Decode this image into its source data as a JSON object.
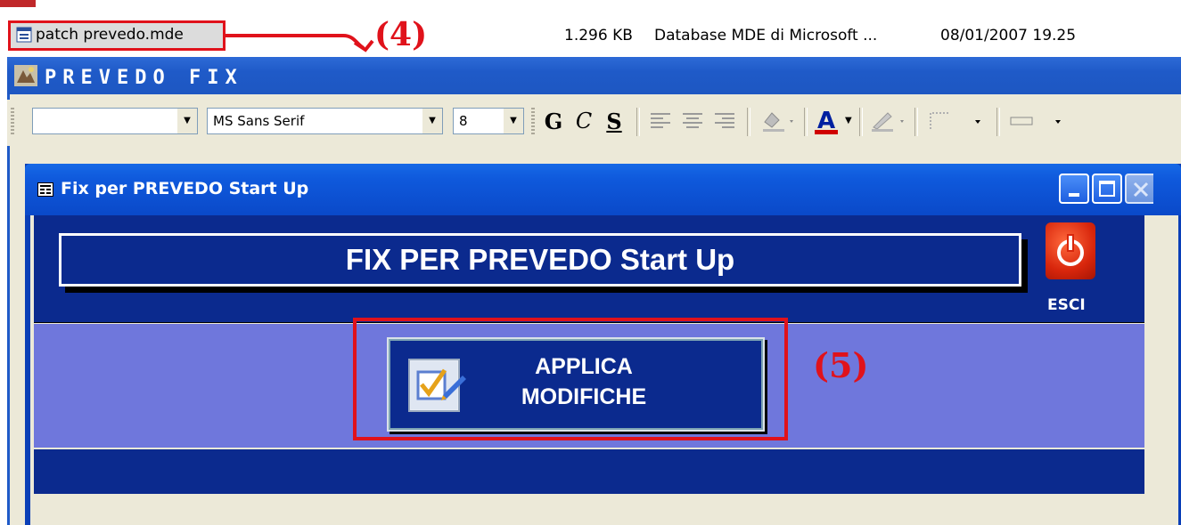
{
  "explorer_row": {
    "file_name": "patch prevedo.mde",
    "file_size": "1.296 KB",
    "file_type": "Database MDE di Microsoft ...",
    "file_date": "08/01/2007 19.25"
  },
  "annotations": {
    "step4": "4",
    "step5": "5",
    "color": "#e0121b"
  },
  "app": {
    "title": "PREVEDO FIX"
  },
  "toolbar": {
    "object_combo": "",
    "font_combo": "MS Sans Serif",
    "size_combo": "8",
    "bold_label": "G",
    "italic_label": "C",
    "underline_label": "S",
    "font_color": "A",
    "font_color_swatch": "#d00000"
  },
  "window": {
    "title": "Fix per PREVEDO Start Up",
    "header_title": "FIX PER PREVEDO Start Up",
    "exit_label": "ESCI",
    "apply_line1": "APPLICA",
    "apply_line2": "MODIFICHE",
    "colors": {
      "header": "#0b2a8e",
      "detail": "#6f77dc"
    }
  }
}
